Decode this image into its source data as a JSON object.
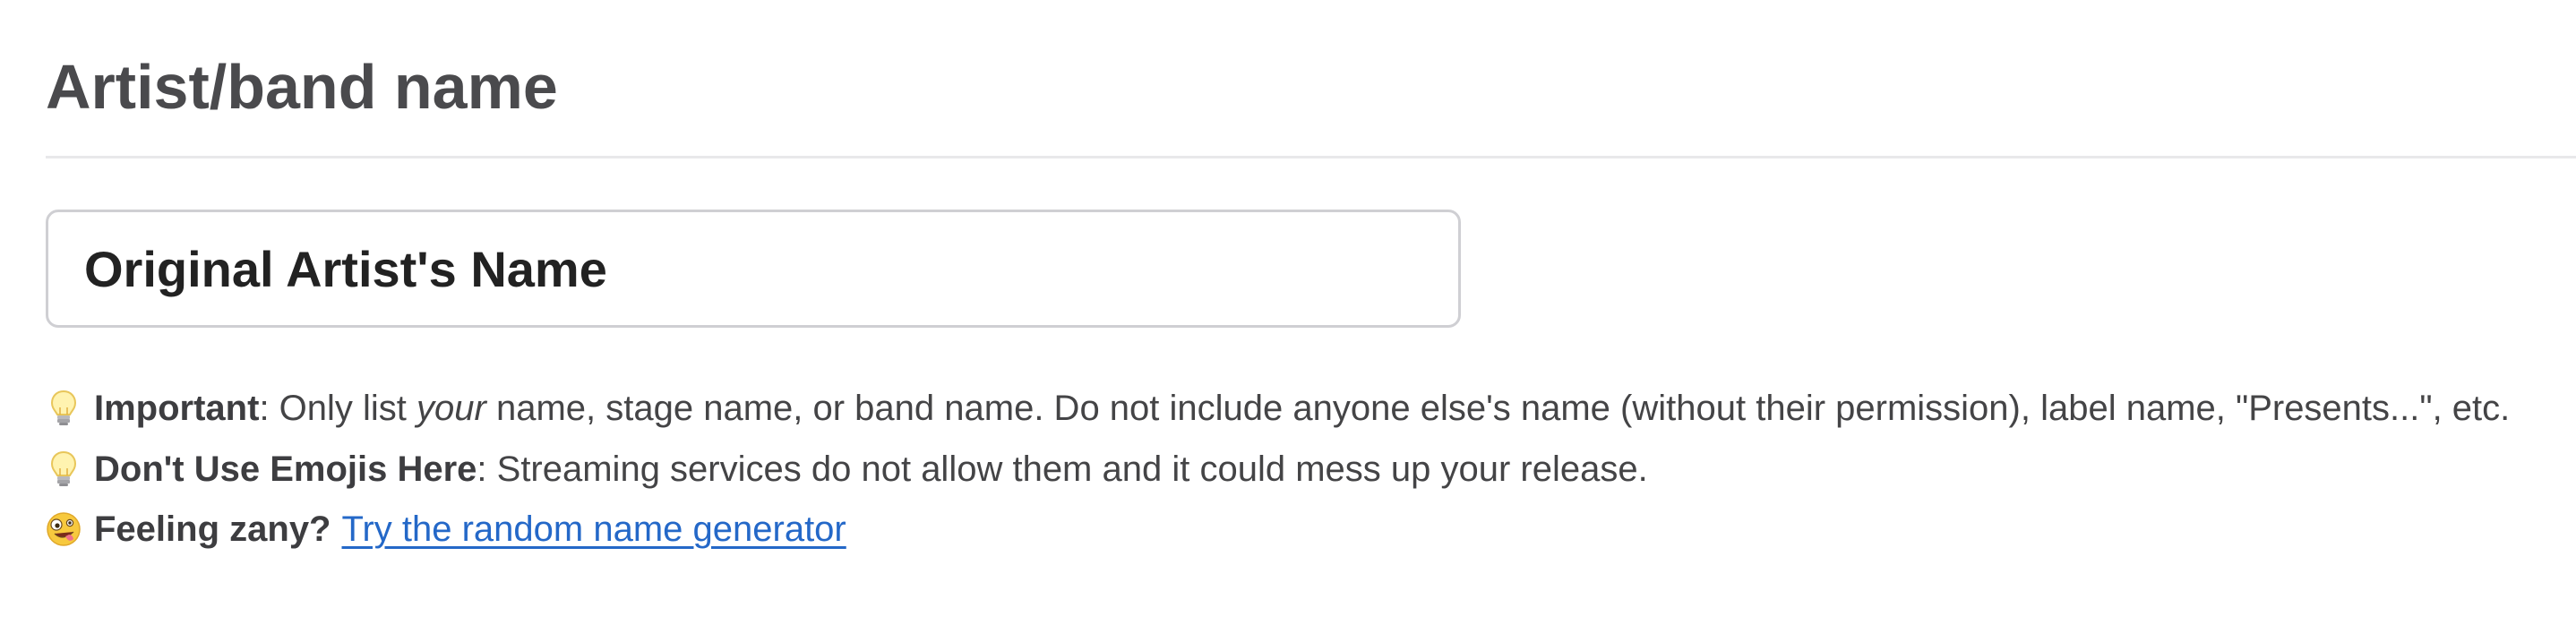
{
  "section": {
    "title": "Artist/band name"
  },
  "artist_input": {
    "placeholder": "Original Artist's Name",
    "value": ""
  },
  "hints": {
    "important": {
      "icon": "lightbulb-icon",
      "label": "Important",
      "text_before": ": Only list ",
      "emphasis": "your",
      "text_after": " name, stage name, or band name. Do not include anyone else's name (without their permission), label name, \"Presents...\", etc."
    },
    "no_emojis": {
      "icon": "lightbulb-icon",
      "label": "Don't Use Emojis Here",
      "text": ": Streaming services do not allow them and it could mess up your release."
    },
    "zany": {
      "icon": "zany-face-icon",
      "label": "Feeling zany?",
      "link_text": "Try the random name generator"
    }
  },
  "colors": {
    "link": "#2468c8",
    "heading": "#4a4a4d",
    "text": "#444446",
    "divider": "#e8e8ea",
    "input_border": "#cfcfd3"
  }
}
